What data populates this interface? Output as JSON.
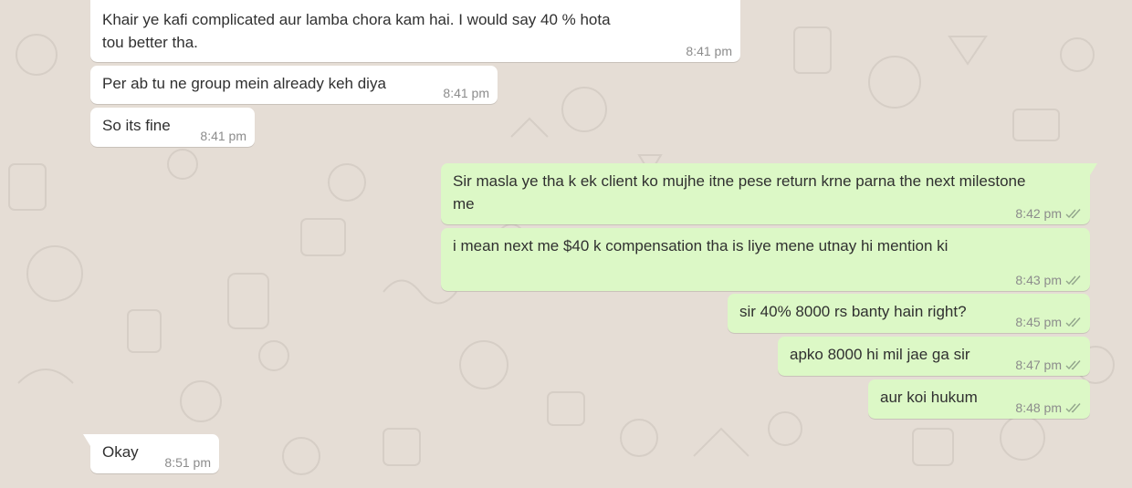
{
  "chat": {
    "messages": [
      {
        "direction": "incoming",
        "text": "Khair ye kafi complicated aur lamba chora kam hai. I would say 40 % hota tou better tha.",
        "time": "8:41 pm"
      },
      {
        "direction": "incoming",
        "text": "Per ab tu ne group mein already keh diya",
        "time": "8:41 pm"
      },
      {
        "direction": "incoming",
        "text": "So its fine",
        "time": "8:41 pm"
      },
      {
        "direction": "outgoing",
        "text": "Sir masla ye tha k ek client ko mujhe itne pese return krne parna the next milestone me",
        "time": "8:42 pm",
        "status": "read"
      },
      {
        "direction": "outgoing",
        "text": "i mean next me $40 k compensation tha is liye mene utnay hi mention ki",
        "time": "8:43 pm",
        "status": "read"
      },
      {
        "direction": "outgoing",
        "text": "sir 40% 8000 rs banty hain right?",
        "time": "8:45 pm",
        "status": "read"
      },
      {
        "direction": "outgoing",
        "text": "apko 8000 hi mil jae ga sir",
        "time": "8:47 pm",
        "status": "read"
      },
      {
        "direction": "outgoing",
        "text": "aur koi hukum",
        "time": "8:48 pm",
        "status": "read"
      }
    ],
    "last": {
      "direction": "incoming",
      "text": "Okay",
      "time": "8:51 pm"
    }
  },
  "colors": {
    "background": "#e5ddd5",
    "incoming_bubble": "#ffffff",
    "outgoing_bubble": "#dcf8c6",
    "timestamp": "#8c8c8c",
    "read_tick": "#92a58c"
  },
  "icons": {
    "read_receipt": "double-check-icon"
  }
}
